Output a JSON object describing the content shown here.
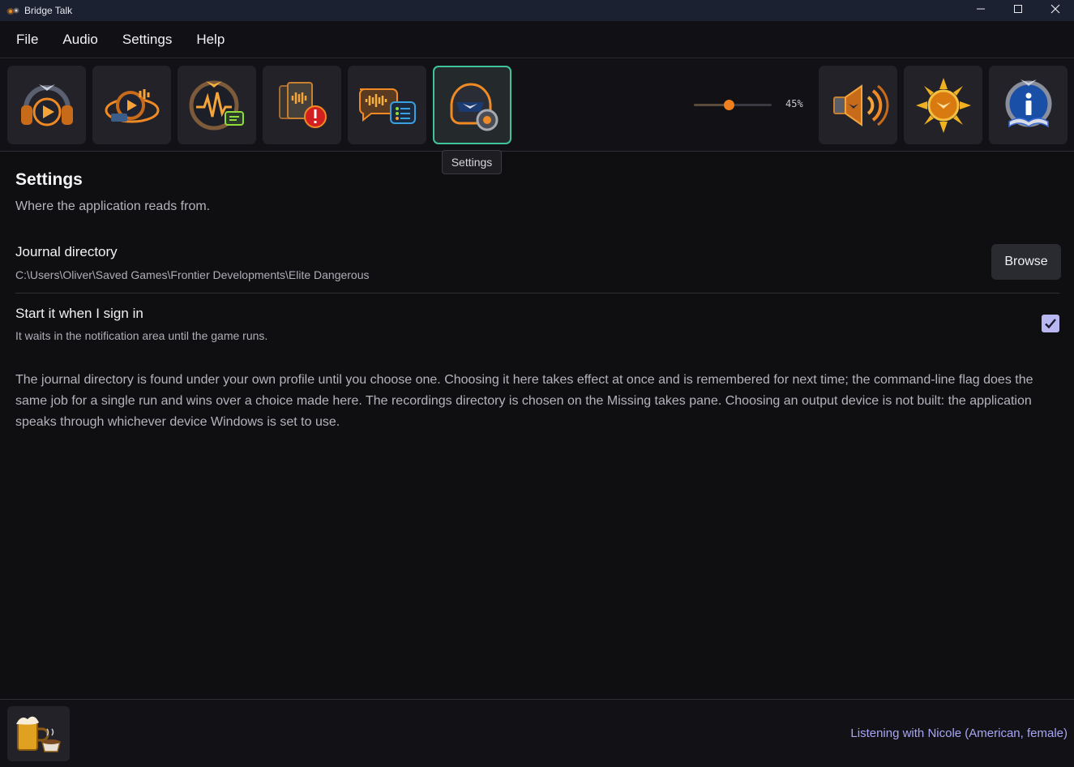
{
  "window": {
    "title": "Bridge Talk",
    "controls": [
      "minimize-icon",
      "maximize-icon",
      "close-icon"
    ]
  },
  "menu": {
    "items": [
      "File",
      "Audio",
      "Settings",
      "Help"
    ]
  },
  "toolbar": {
    "buttons": [
      {
        "name": "play-headphones-icon",
        "active": false
      },
      {
        "name": "recordings-icon",
        "active": false
      },
      {
        "name": "waveform-monitor-icon",
        "active": false
      },
      {
        "name": "missing-takes-icon",
        "active": false
      },
      {
        "name": "chat-sound-icon",
        "active": false
      },
      {
        "name": "settings-helmet-icon",
        "active": true
      },
      {
        "name": "speaker-volume-icon",
        "active": false
      },
      {
        "name": "brightness-icon",
        "active": false
      },
      {
        "name": "info-book-icon",
        "active": false
      }
    ],
    "volume": {
      "value": 0.45,
      "label": "45%"
    },
    "tooltip": "Settings"
  },
  "settings": {
    "heading": "Settings",
    "subheading": "Where the application reads from.",
    "journal": {
      "label": "Journal directory",
      "path": "C:\\Users\\Oliver\\Saved Games\\Frontier Developments\\Elite Dangerous",
      "browse_label": "Browse"
    },
    "startup": {
      "label": "Start it when I sign in",
      "description": "It waits in the notification area until the game runs.",
      "checked": true
    },
    "note": "The journal directory is found under your own profile until you choose one. Choosing it here takes effect at once and is remembered for next time; the command-line flag does the same job for a single run and wins over a choice made here. The recordings directory is chosen on the Missing takes pane. Choosing an output device is not built: the application speaks through whichever device Windows is set to use."
  },
  "status": {
    "icon": "beer-coffee-icon",
    "text": "Listening with Nicole (American, female)"
  },
  "colors": {
    "accent": "#f07f1e",
    "active_border": "#3fc39a",
    "status_text": "#a9a6f5",
    "checkbox": "#b9b7f2"
  }
}
